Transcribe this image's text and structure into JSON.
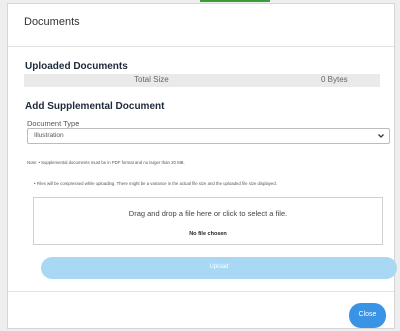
{
  "modal": {
    "title": "Documents"
  },
  "uploaded": {
    "heading": "Uploaded Documents",
    "total_size_label": "Total Size",
    "total_size_value": "0 Bytes"
  },
  "add": {
    "heading": "Add Supplemental Document",
    "doc_type_label": "Document Type",
    "doc_type_selected": "Illustration",
    "note": "Note: • Supplemental documents must be in PDF format and no larger than 20 MB.",
    "note2": "• Files will be compressed while uploading. There might be a variance in the actual file size and the uploaded file size displayed."
  },
  "dropzone": {
    "text": "Drag and drop a file here or click to select a file.",
    "status": "No file chosen"
  },
  "buttons": {
    "upload": "Upload",
    "close": "Close"
  },
  "colors": {
    "accent": "#3b93e6",
    "upload_disabled": "#a9d8f5",
    "top_accent": "#3a9d3a"
  },
  "icons": {
    "select_chevron": "chevron-down-icon"
  }
}
